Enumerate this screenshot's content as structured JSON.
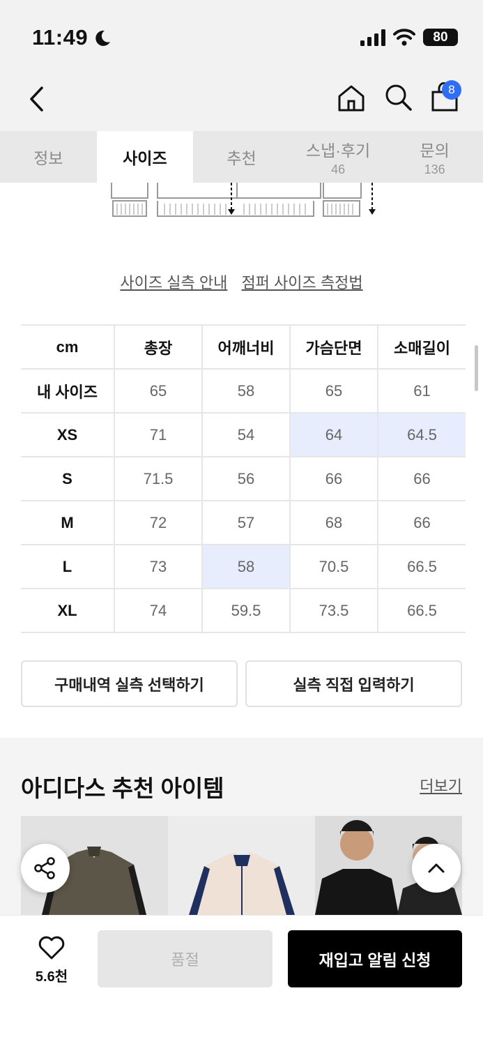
{
  "status": {
    "time": "11:49",
    "battery": "80"
  },
  "nav": {
    "cart_count": "8"
  },
  "tabs": [
    {
      "label": "정보",
      "count": ""
    },
    {
      "label": "사이즈",
      "count": ""
    },
    {
      "label": "추천",
      "count": ""
    },
    {
      "label": "스냅·후기",
      "count": "46"
    },
    {
      "label": "문의",
      "count": "136"
    }
  ],
  "guide": {
    "measure_link": "사이즈 실측 안내",
    "method_link": "점퍼 사이즈 측정법"
  },
  "size_table": {
    "headers": [
      "cm",
      "총장",
      "어깨너비",
      "가슴단면",
      "소매길이"
    ],
    "rows": [
      [
        "내 사이즈",
        "65",
        "58",
        "65",
        "61"
      ],
      [
        "XS",
        "71",
        "54",
        "64",
        "64.5"
      ],
      [
        "S",
        "71.5",
        "56",
        "66",
        "66"
      ],
      [
        "M",
        "72",
        "57",
        "68",
        "66"
      ],
      [
        "L",
        "73",
        "58",
        "70.5",
        "66.5"
      ],
      [
        "XL",
        "74",
        "59.5",
        "73.5",
        "66.5"
      ]
    ]
  },
  "buttons": {
    "purchase_history": "구매내역 실측 선택하기",
    "manual_input": "실측 직접 입력하기"
  },
  "recommend": {
    "title": "아디다스 추천 아이템",
    "more": "더보기"
  },
  "bottom": {
    "like_count": "5.6천",
    "soldout": "품절",
    "restock": "재입고 알림 신청"
  },
  "colors": {
    "highlight": "#e7edfd",
    "badge": "#2f6ef2",
    "primary_button": "#000000"
  }
}
